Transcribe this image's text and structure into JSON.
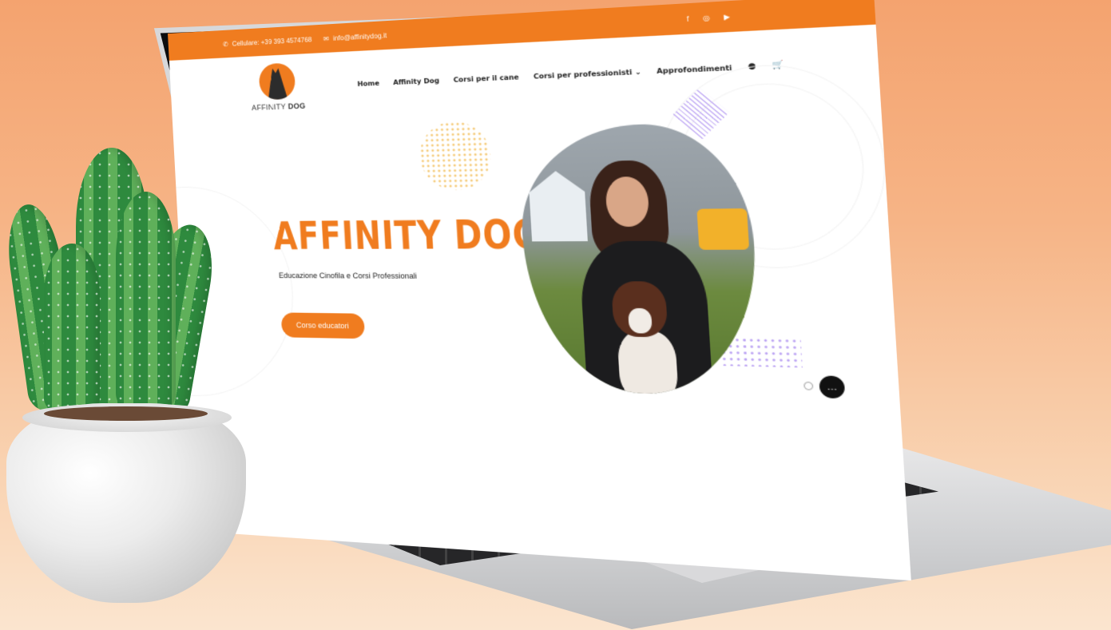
{
  "topbar": {
    "phone": "Cellulare: +39 393 4574768",
    "email": "info@affinitydog.it",
    "socials": [
      "f",
      "◎",
      "▶"
    ]
  },
  "brand": {
    "logo_text_1": "AFFINITY",
    "logo_text_2": "DOG"
  },
  "menu": {
    "items": [
      "Home",
      "Affinity Dog",
      "Corsi per il cane",
      "Corsi per professionisti",
      "Approfondimenti"
    ],
    "dropdown_indicator": "⌄"
  },
  "hero": {
    "title": "AFFINITY DOG",
    "subtitle": "Educazione Cinofila e Corsi Professionali",
    "cta": "Corso educatori"
  },
  "icons": {
    "phone": "phone-icon",
    "mail": "mail-icon",
    "user": "user-icon",
    "cart": "cart-icon",
    "chat": "chat-icon"
  },
  "colors": {
    "accent": "#f07c1f",
    "background_top": "#f4a36f",
    "background_bottom": "#fbe5cf"
  }
}
